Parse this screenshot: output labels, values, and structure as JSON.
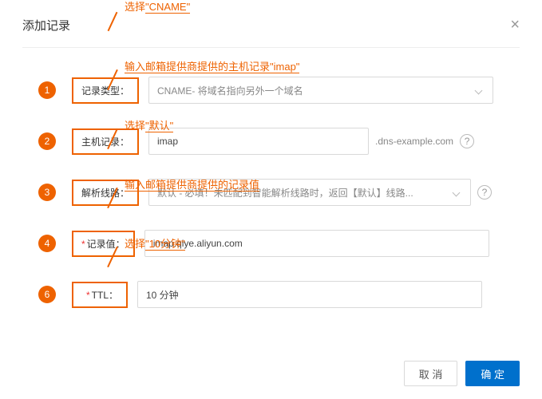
{
  "modal": {
    "title": "添加记录",
    "close": "×"
  },
  "annotations": {
    "a1_prefix": "选择",
    "a1_value": "\"CNAME\"",
    "a2_prefix": "输入邮箱提供商提供的主机记录",
    "a2_value": "\"imap\"",
    "a3_prefix": "选择",
    "a3_value": "\"默认\"",
    "a4": "输入邮箱提供商提供的记录值",
    "a6_prefix": "选择",
    "a6_value": "\"10分钟\""
  },
  "steps": {
    "s1": "1",
    "s2": "2",
    "s3": "3",
    "s4": "4",
    "s6": "6"
  },
  "labels": {
    "record_type": "记录类型：",
    "host_record": "主机记录：",
    "line": "解析线路：",
    "record_value": "记录值：",
    "ttl": "TTL："
  },
  "fields": {
    "record_type_placeholder": "CNAME- 将域名指向另外一个域名",
    "host_record_value": "imap",
    "host_record_suffix": ".dns-example.com",
    "line_placeholder": "默认 - 必填！未匹配到智能解析线路时，返回【默认】线路...",
    "record_value_value": "imap.qiye.aliyun.com",
    "ttl_value": "10 分钟"
  },
  "buttons": {
    "cancel": "取 消",
    "confirm": "确 定"
  },
  "asterisk": "*",
  "help": "?"
}
